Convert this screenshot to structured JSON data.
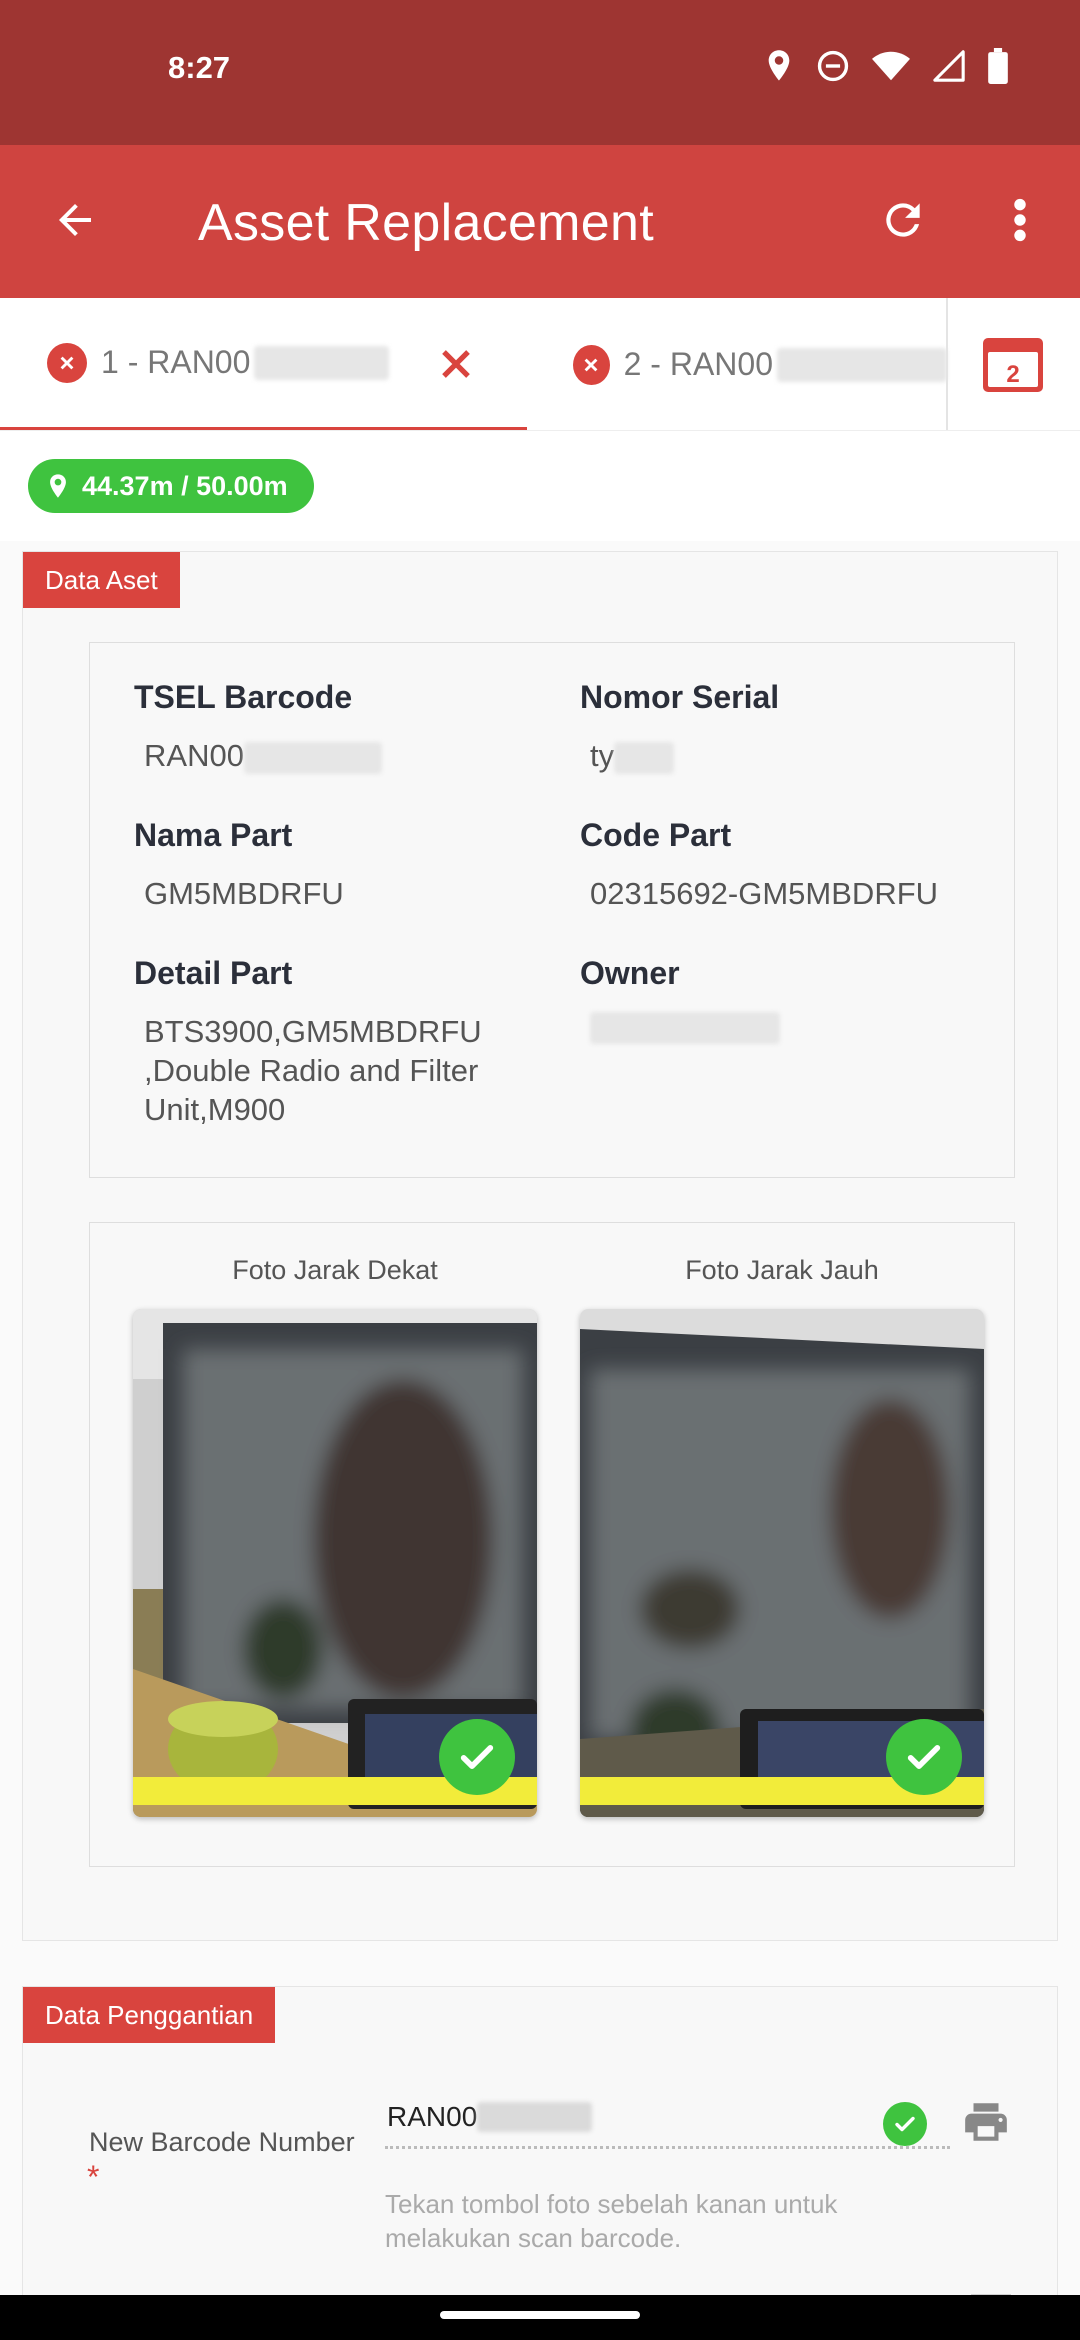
{
  "status_bar": {
    "time": "8:27",
    "icons": [
      "location-icon",
      "do-not-disturb-icon",
      "wifi-icon",
      "signal-icon",
      "battery-icon"
    ]
  },
  "app_bar": {
    "title": "Asset Replacement",
    "back_icon": "arrow-back-icon",
    "refresh_icon": "refresh-icon",
    "more_icon": "more-vert-icon",
    "color": "#cf4440"
  },
  "tabs": [
    {
      "label": "1 - RAN00",
      "active": true
    },
    {
      "label": "2 - RAN00",
      "active": false
    }
  ],
  "calendar_badge": "2",
  "distance": "44.37m / 50.00m",
  "data_aset": {
    "title": "Data Aset",
    "fields": {
      "tsel_barcode": {
        "label": "TSEL Barcode",
        "value": "RAN00"
      },
      "nomor_serial": {
        "label": "Nomor Serial",
        "value": "ty"
      },
      "nama_part": {
        "label": "Nama Part",
        "value": "GM5MBDRFU"
      },
      "code_part": {
        "label": "Code Part",
        "value": "02315692-GM5MBDRFU"
      },
      "detail_part": {
        "label": "Detail Part",
        "lines": [
          "BTS3900,GM5MBDRFU",
          ",Double Radio and Filter",
          "Unit,M900"
        ]
      },
      "owner": {
        "label": "Owner",
        "value": ""
      }
    },
    "photos": {
      "near": {
        "caption": "Foto Jarak Dekat",
        "verified": true
      },
      "far": {
        "caption": "Foto Jarak Jauh",
        "verified": true
      }
    }
  },
  "data_penggantian": {
    "title": "Data Penggantian",
    "new_barcode": {
      "label": "New Barcode Number",
      "required_mark": "*",
      "value": "RAN00",
      "hint": "Tekan tombol foto sebelah kanan untuk melakukan scan barcode."
    }
  },
  "colors": {
    "accent": "#d9443e",
    "success": "#3fc33f",
    "status_bar": "#9e3532"
  }
}
